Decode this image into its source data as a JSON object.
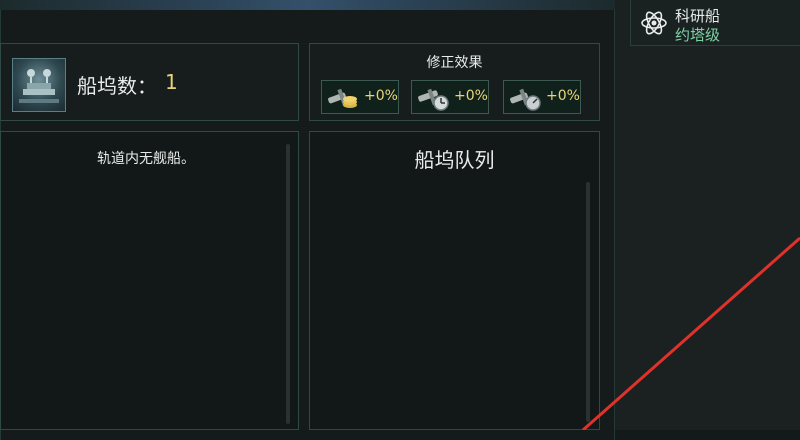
{
  "dock": {
    "count_label": "船坞数：",
    "count_value": "1"
  },
  "modifiers": {
    "title": "修正效果",
    "items": [
      {
        "icon": "credits-hammer-icon",
        "value": "+0%"
      },
      {
        "icon": "time-hammer-icon",
        "value": "+0%"
      },
      {
        "icon": "speed-hammer-icon",
        "value": "+0%"
      }
    ]
  },
  "orbit": {
    "empty_text": "轨道内无舰船。"
  },
  "queue": {
    "title": "船坞队列"
  },
  "ship_card": {
    "type": "科研船",
    "name": "约塔级",
    "icon": "atom-icon"
  },
  "colors": {
    "accent_yellow": "#e9d27a",
    "accent_green": "#7fd0a5",
    "annotation_red": "#e0322b"
  }
}
